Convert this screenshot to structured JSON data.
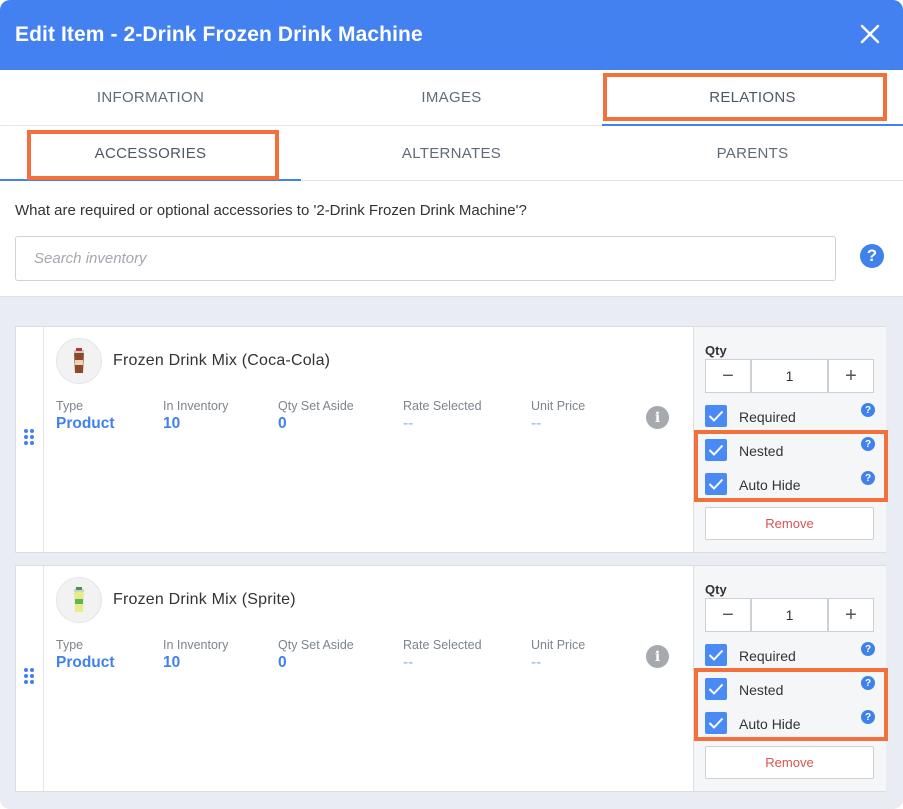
{
  "header": {
    "title": "Edit Item - 2-Drink Frozen Drink Machine"
  },
  "tabs": [
    {
      "label": "INFORMATION"
    },
    {
      "label": "IMAGES"
    },
    {
      "label": "RELATIONS"
    }
  ],
  "subtabs": [
    {
      "label": "ACCESSORIES"
    },
    {
      "label": "ALTERNATES"
    },
    {
      "label": "PARENTS"
    }
  ],
  "question": "What are required or optional accessories to '2-Drink Frozen Drink Machine'?",
  "search": {
    "placeholder": "Search inventory"
  },
  "stat_labels": {
    "type": "Type",
    "in_inventory": "In Inventory",
    "qty_set_aside": "Qty Set Aside",
    "rate_selected": "Rate Selected",
    "unit_price": "Unit Price"
  },
  "side_labels": {
    "qty": "Qty",
    "required": "Required",
    "nested": "Nested",
    "auto_hide": "Auto Hide",
    "remove": "Remove"
  },
  "items": [
    {
      "name": "Frozen Drink Mix (Coca-Cola)",
      "type": "Product",
      "in_inventory": "10",
      "qty_set_aside": "0",
      "rate_selected": "--",
      "unit_price": "--",
      "qty": "1",
      "required": true,
      "nested": true,
      "auto_hide": true
    },
    {
      "name": "Frozen Drink Mix (Sprite)",
      "type": "Product",
      "in_inventory": "10",
      "qty_set_aside": "0",
      "rate_selected": "--",
      "unit_price": "--",
      "qty": "1",
      "required": true,
      "nested": true,
      "auto_hide": true
    }
  ],
  "colors": {
    "accent": "#4381f1",
    "highlight": "#f36f3c",
    "remove": "#d9534f"
  }
}
